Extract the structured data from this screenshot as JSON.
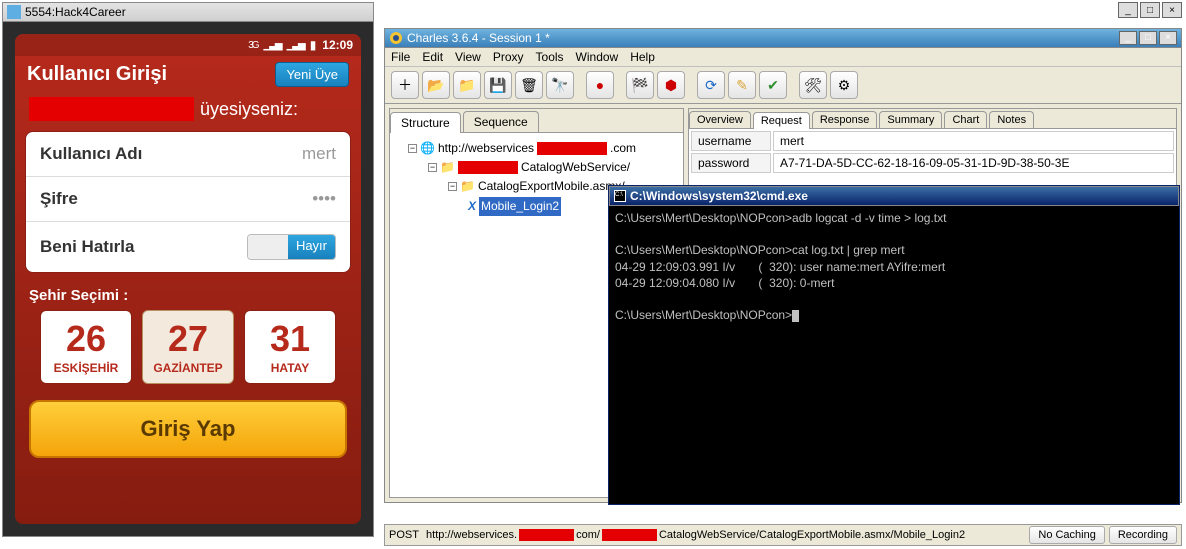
{
  "emulator": {
    "window_title": "5554:Hack4Career",
    "status_time": "12:09",
    "status_net": "3G",
    "app_title": "Kullanıcı Girişi",
    "new_member": "Yeni Üye",
    "if_member": "üyesiyseniz:",
    "username_label": "Kullanıcı Adı",
    "username_value": "mert",
    "password_label": "Şifre",
    "password_value": "••••",
    "remember_label": "Beni Hatırla",
    "remember_value": "Hayır",
    "city_section": "Şehir Seçimi :",
    "cities": [
      {
        "num": "26",
        "name": "ESKİŞEHİR"
      },
      {
        "num": "27",
        "name": "GAZİANTEP"
      },
      {
        "num": "31",
        "name": "HATAY"
      }
    ],
    "login_btn": "Giriş Yap"
  },
  "charles": {
    "window_title": "Charles 3.6.4 - Session 1 *",
    "menu": [
      "File",
      "Edit",
      "View",
      "Proxy",
      "Tools",
      "Window",
      "Help"
    ],
    "left_tabs": [
      "Structure",
      "Sequence"
    ],
    "tree": {
      "host_prefix": "http://webservices",
      "host_suffix": ".com",
      "path1_suffix": "CatalogWebService/",
      "path2": "CatalogExportMobile.asmx/",
      "leaf": "Mobile_Login2"
    },
    "right_tabs": [
      "Overview",
      "Request",
      "Response",
      "Summary",
      "Chart",
      "Notes"
    ],
    "request": {
      "username_key": "username",
      "username_val": "mert",
      "password_key": "password",
      "password_val": "A7-71-DA-5D-CC-62-18-16-09-05-31-1D-9D-38-50-3E"
    },
    "status": {
      "method": "POST",
      "url_prefix": "http://webservices.",
      "url_mid": "com/",
      "url_suffix": "CatalogWebService/CatalogExportMobile.asmx/Mobile_Login2",
      "btn1": "No Caching",
      "btn2": "Recording"
    }
  },
  "cmd": {
    "window_title": "C:\\Windows\\system32\\cmd.exe",
    "lines": "C:\\Users\\Mert\\Desktop\\NOPcon>adb logcat -d -v time > log.txt\n\nC:\\Users\\Mert\\Desktop\\NOPcon>cat log.txt | grep mert\n04-29 12:09:03.991 I/v       (  320): user name:mert AYifre:mert\n04-29 12:09:04.080 I/v       (  320): 0-mert\n\nC:\\Users\\Mert\\Desktop\\NOPcon>"
  }
}
